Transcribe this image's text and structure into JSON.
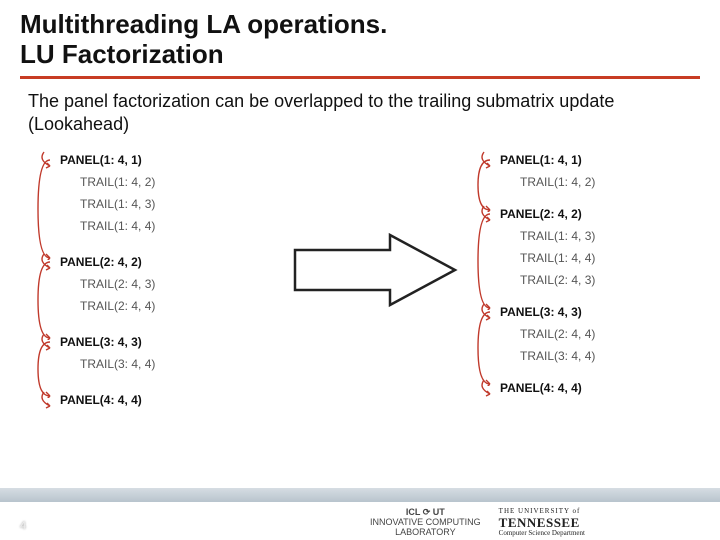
{
  "title_line1": "Multithreading LA operations.",
  "title_line2": " LU Factorization",
  "subtitle": "The panel factorization can be overlapped to the trailing submatrix update (Lookahead)",
  "left_steps": [
    {
      "label": "PANEL(1: 4, 1)",
      "type": "panel"
    },
    {
      "label": "TRAIL(1: 4, 2)",
      "type": "trail"
    },
    {
      "label": "TRAIL(1: 4, 3)",
      "type": "trail"
    },
    {
      "label": "TRAIL(1: 4, 4)",
      "type": "trail"
    },
    {
      "label": "PANEL(2: 4, 2)",
      "type": "panel"
    },
    {
      "label": "TRAIL(2: 4, 3)",
      "type": "trail"
    },
    {
      "label": "TRAIL(2: 4, 4)",
      "type": "trail"
    },
    {
      "label": "PANEL(3: 4, 3)",
      "type": "panel"
    },
    {
      "label": "TRAIL(3: 4, 4)",
      "type": "trail"
    },
    {
      "label": "PANEL(4: 4, 4)",
      "type": "panel"
    }
  ],
  "right_steps": [
    {
      "label": "PANEL(1: 4, 1)",
      "type": "panel"
    },
    {
      "label": "TRAIL(1: 4, 2)",
      "type": "trail"
    },
    {
      "label": "PANEL(2: 4, 2)",
      "type": "panel"
    },
    {
      "label": "TRAIL(1: 4, 3)",
      "type": "trail"
    },
    {
      "label": "TRAIL(1: 4, 4)",
      "type": "trail"
    },
    {
      "label": "TRAIL(2: 4, 3)",
      "type": "trail"
    },
    {
      "label": "PANEL(3: 4, 3)",
      "type": "panel"
    },
    {
      "label": "TRAIL(2: 4, 4)",
      "type": "trail"
    },
    {
      "label": "TRAIL(3: 4, 4)",
      "type": "trail"
    },
    {
      "label": "PANEL(4: 4, 4)",
      "type": "panel"
    }
  ],
  "page_number": "4",
  "logos": {
    "icl_top": "ICL ⟳ UT",
    "icl_line1": "INNOVATIVE COMPUTING",
    "icl_line2": "LABORATORY",
    "ut_the": "THE UNIVERSITY of",
    "ut_name": "TENNESSEE",
    "ut_dept": "Computer Science Department"
  }
}
